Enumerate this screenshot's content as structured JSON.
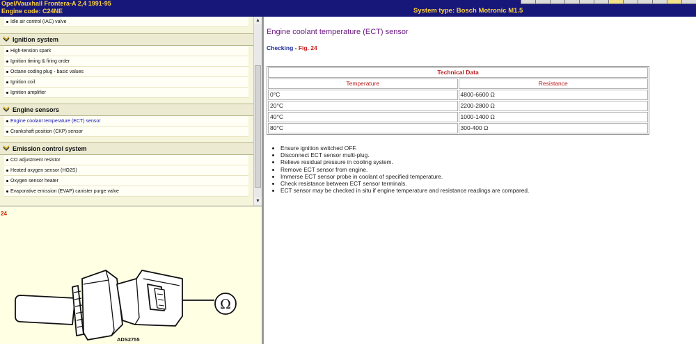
{
  "header": {
    "vehicle": "Opel/Vauxhall   Frontera-A  2,4  1991-95",
    "engine_code": "Engine code: C24NE",
    "system_type": "System type: Bosch Motronic M1.5"
  },
  "nav": {
    "top_item": "Idle air control (IAC) valve",
    "ignition": {
      "title": "Ignition system",
      "items": [
        "High-tension spark",
        "Ignition timing & firing order",
        "Octane coding plug - basic values",
        "Ignition coil",
        "Ignition amplifier"
      ]
    },
    "sensors": {
      "title": "Engine sensors",
      "items": [
        "Engine coolant temperature (ECT) sensor",
        "Crankshaft position (CKP) sensor"
      ]
    },
    "emission": {
      "title": "Emission control system",
      "items": [
        "CO adjustment resistor",
        "Heated oxygen sensor (HO2S)",
        "Oxygen sensor heater",
        "Evaporative emission (EVAP) canister purge valve"
      ]
    }
  },
  "figure": {
    "ref": "24",
    "code": "ADS2755"
  },
  "content": {
    "title": "Engine coolant temperature (ECT) sensor",
    "checking": "Checking",
    "separator": " - ",
    "fig_link": "Fig. 24",
    "table": {
      "caption": "Technical Data",
      "headers": [
        "Temperature",
        "Resistance"
      ],
      "rows": [
        [
          "0°C",
          "4800-6600 Ω"
        ],
        [
          "20°C",
          "2200-2800 Ω"
        ],
        [
          "40°C",
          "1000-1400 Ω"
        ],
        [
          "80°C",
          "300-400 Ω"
        ]
      ]
    },
    "steps": [
      "Ensure ignition switched OFF.",
      "Disconnect ECT sensor multi-plug.",
      "Relieve residual pressure in cooling system.",
      "Remove ECT sensor from engine.",
      "Immerse ECT sensor probe in coolant of specified temperature.",
      "Check resistance between ECT sensor terminals.",
      "ECT sensor may be checked in situ if engine temperature and resistance readings are compared."
    ]
  },
  "colors": {
    "header_bg": "#17177a",
    "header_text": "#ffd23a",
    "title": "#6b1a80",
    "link": "#1e2c9a",
    "red": "#c81e1e"
  }
}
